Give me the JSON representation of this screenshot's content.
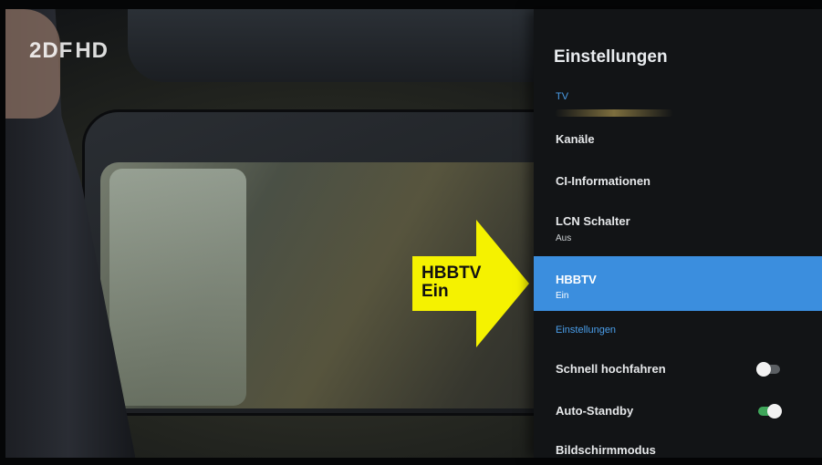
{
  "channel": {
    "logo_text": "2DF",
    "logo_hd": "HD"
  },
  "annotation": {
    "line1": "HBBTV",
    "line2": "Ein",
    "color": "#f5f200"
  },
  "panel": {
    "title": "Einstellungen",
    "section_tv": "TV",
    "items": [
      {
        "label": "Kanäle",
        "sub": ""
      },
      {
        "label": "CI-Informationen",
        "sub": ""
      },
      {
        "label": "LCN Schalter",
        "sub": "Aus"
      },
      {
        "label": "HBBTV",
        "sub": "Ein",
        "selected": true
      }
    ],
    "section_settings": "Einstellungen",
    "toggles": [
      {
        "label": "Schnell hochfahren",
        "state": "off"
      },
      {
        "label": "Auto-Standby",
        "state": "on"
      }
    ],
    "last_item": "Bildschirmmodus",
    "accent_color": "#3b8ede"
  }
}
